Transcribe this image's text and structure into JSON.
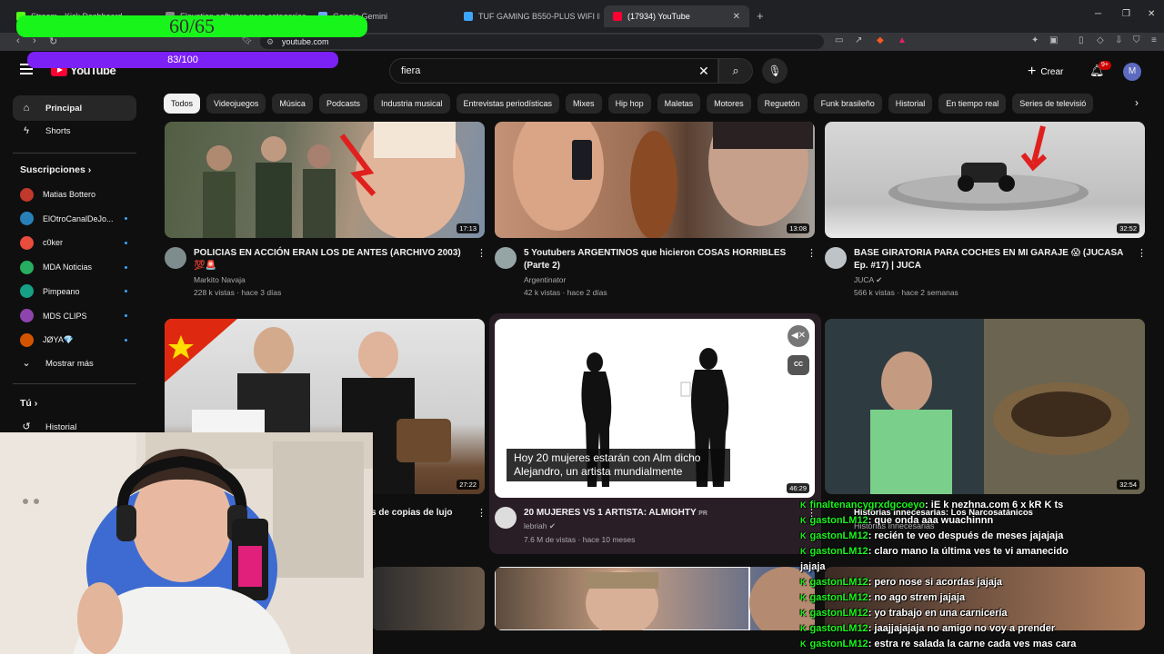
{
  "browser": {
    "tabs": [
      {
        "label": "Stream - Kick Dashboard",
        "fav": "#53fc18"
      },
      {
        "label": "Elevation software para categorías tv",
        "fav": "#888888"
      },
      {
        "label": "Google Gemini",
        "fav": "#6ea8fe"
      },
      {
        "label": "TUF GAMING B550-PLUS WIFI II | M",
        "fav": "#3ea6ff"
      },
      {
        "label": "(17934) YouTube",
        "fav": "#ff0033"
      }
    ],
    "new_tab": "+",
    "url": "youtube.com"
  },
  "overlay": {
    "counter1": "60/65",
    "counter2": "83/100"
  },
  "header": {
    "logo": "YouTube",
    "search_value": "fiera",
    "create_label": "Crear",
    "notifications": "9+",
    "avatar_letter": "M"
  },
  "sidebar": {
    "main": [
      {
        "label": "Principal",
        "icon": "home-icon"
      },
      {
        "label": "Shorts",
        "icon": "shorts-icon"
      }
    ],
    "subs_heading": "Suscripciones",
    "subs": [
      {
        "label": "Matias Bottero",
        "color": "#c0392b",
        "live": false
      },
      {
        "label": "ElOtroCanalDeJo...",
        "color": "#2980b9",
        "live": true
      },
      {
        "label": "c0ker",
        "color": "#e74c3c",
        "live": true
      },
      {
        "label": "MDA Noticias",
        "color": "#27ae60",
        "live": true
      },
      {
        "label": "Pimpeano",
        "color": "#16a085",
        "live": true
      },
      {
        "label": "MDS CLIPS",
        "color": "#8e44ad",
        "live": true
      },
      {
        "label": "JØYA💎",
        "color": "#d35400",
        "live": true
      }
    ],
    "show_more": "Mostrar más",
    "you_heading": "Tú",
    "history": "Historial"
  },
  "chips": [
    "Todos",
    "Videojuegos",
    "Música",
    "Podcasts",
    "Industria musical",
    "Entrevistas periodísticas",
    "Mixes",
    "Hip hop",
    "Maletas",
    "Motores",
    "Reguetón",
    "Funk brasileño",
    "Historial",
    "En tiempo real",
    "Series de televisió"
  ],
  "videos": [
    {
      "title1": "POLICIAS EN ACCIÓN ERAN LOS DE ANTES (ARCHIVO 2003)",
      "title2": "💯🚨",
      "channel": "Markito Navaja",
      "meta": "228 k vistas · hace 3 días",
      "duration": "17:13",
      "av": "#7f8c8d"
    },
    {
      "title1": "5 Youtubers ARGENTINOS que hicieron COSAS HORRIBLES",
      "title2": "(Parte 2)",
      "channel": "Argentinator",
      "meta": "42 k vistas · hace 2 días",
      "duration": "13:08",
      "av": "#95a5a6"
    },
    {
      "title1": "BASE GIRATORIA PARA COCHES EN MI GARAJE 😱 (JUCASA",
      "title2": "Ep. #17) | JUCA",
      "channel": "JUCA",
      "meta": "566 k vistas · hace 2 semanas",
      "duration": "32:52",
      "av": "#bdc3c7"
    },
    {
      "title1": "s de copias de lujo",
      "duration": "27:22"
    },
    {
      "title1": "20 MUJERES VS 1 ARTISTA: ALMIGHTY",
      "badge": "PR",
      "channel": "lebriah",
      "meta": "7.6 M de vistas · hace 10 meses",
      "duration": "46:29",
      "av": "#dddddd"
    },
    {
      "title1": "Historias Innecesarias: Los Narcosatánicos",
      "channel": "Historias Innecesarias",
      "duration": "32:54"
    }
  ],
  "player": {
    "subtitle": "Hoy 20 mujeres estarán con Alm dicho Alejandro, un artista mundialmente",
    "cc": "CC"
  },
  "chat": [
    {
      "user": "finaltenancygrxdgcoeyo",
      "msg": "iE k nezhna.com 6 x kR K ts"
    },
    {
      "user": "gastonLM12",
      "msg": "que onda aaa wuachinnn"
    },
    {
      "user": "gastonLM12",
      "msg": "recién te veo después de meses jajajaja"
    },
    {
      "user": "gastonLM12",
      "msg": "claro mano la última ves te vi amanecido"
    },
    {
      "user": "",
      "msg": "jajaja"
    },
    {
      "user": "gastonLM12",
      "msg": "pero nose si acordas jajaja"
    },
    {
      "user": "gastonLM12",
      "msg": "no ago strem jajaja"
    },
    {
      "user": "gastonLM12",
      "msg": "yo trabajo en una carnicería"
    },
    {
      "user": "gastonLM12",
      "msg": "jaajjajajaja no amigo no voy a prender"
    },
    {
      "user": "gastonLM12",
      "msg": "estra re salada la carne cada ves mas cara"
    }
  ],
  "colors": {
    "bg": "#0f0f0f",
    "chip": "#272727",
    "accent": "#ff0033",
    "chat_user": "#18f51a",
    "counter1": "#18f51a",
    "counter2": "#7b21f5"
  }
}
